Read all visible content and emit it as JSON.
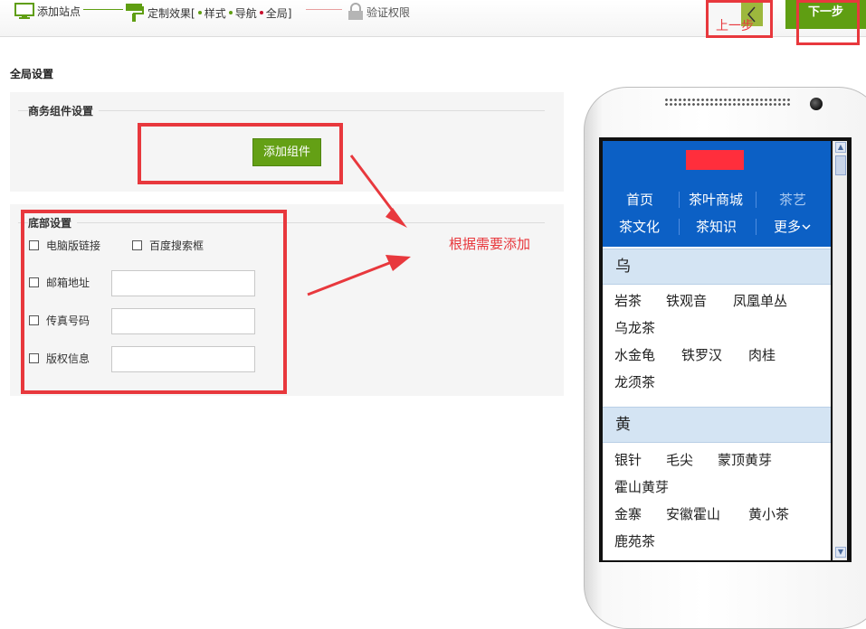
{
  "steps": {
    "step1": "添加站点",
    "step2": "定制效果[",
    "step2_subs": [
      "样式",
      "导航",
      "全局]"
    ],
    "step3": "验证权限"
  },
  "toolbar": {
    "prev_label": "上一步",
    "next_label": "下一步"
  },
  "page": {
    "title": "全局设置"
  },
  "business": {
    "legend": "商务组件设置",
    "add_button": "添加组件"
  },
  "footer": {
    "legend": "底部设置",
    "pc_link": "电脑版链接",
    "baidu_search": "百度搜索框",
    "email": "邮箱地址",
    "fax": "传真号码",
    "copyright": "版权信息"
  },
  "annotation": "根据需要添加",
  "preview": {
    "nav_row1": [
      "首页",
      "茶叶商城",
      "茶艺"
    ],
    "nav_row2": [
      "茶文化",
      "茶知识",
      "更多"
    ],
    "categories": [
      {
        "name": "乌",
        "rows": [
          [
            "岩茶",
            "铁观音",
            "凤凰单丛"
          ],
          [
            "乌龙茶"
          ],
          [
            "水金龟",
            "铁罗汉",
            "肉桂"
          ],
          [
            "龙须茶"
          ]
        ]
      },
      {
        "name": "黄",
        "rows": [
          [
            "银针",
            "毛尖",
            "蒙顶黄芽"
          ],
          [
            "霍山黄芽"
          ],
          [
            "金寨",
            "安徽霍山",
            "黄小茶"
          ],
          [
            "鹿苑茶"
          ]
        ]
      }
    ]
  },
  "colors": {
    "accent_red": "#e8383d",
    "green": "#64a015",
    "mobile_blue": "#0c60c5"
  }
}
